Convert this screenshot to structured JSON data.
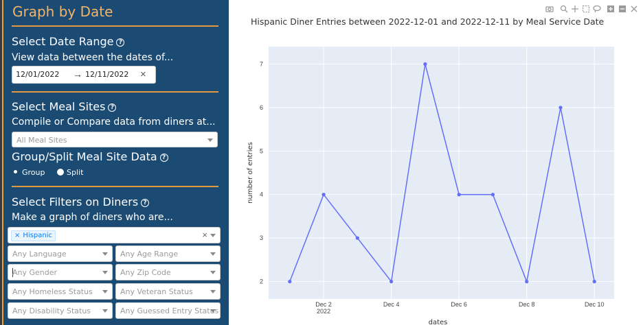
{
  "sidebar": {
    "title": "Graph by Date",
    "date_section": {
      "heading": "Select Date Range",
      "subtitle": "View data between the dates of...",
      "start_date": "12/01/2022",
      "arrow": "→",
      "end_date": "12/11/2022",
      "clear": "×"
    },
    "sites_section": {
      "heading": "Select Meal Sites",
      "subtitle": "Compile or Compare data from diners at...",
      "placeholder": "All Meal Sites"
    },
    "group_section": {
      "heading": "Group/Split Meal Site Data",
      "option_group": "Group",
      "option_split": "Split",
      "selected": "Group"
    },
    "filters_section": {
      "heading": "Select Filters on Diners",
      "subtitle": "Make a graph of diners who are...",
      "tag": "Hispanic",
      "tag_remove": "×",
      "clear_all": "×",
      "dropdowns": [
        {
          "placeholder": "Any Language"
        },
        {
          "placeholder": "Any Age Range"
        },
        {
          "placeholder": "Any Gender"
        },
        {
          "placeholder": "Any Zip Code"
        },
        {
          "placeholder": "Any Homeless Status"
        },
        {
          "placeholder": "Any Veteran Status"
        },
        {
          "placeholder": "Any Disability Status"
        },
        {
          "placeholder": "Any Guessed Entry Status"
        }
      ]
    },
    "help_glyph": "?"
  },
  "modebar": {
    "icons": [
      "camera-icon",
      "zoom-icon",
      "pan-icon",
      "box-select-icon",
      "lasso-icon",
      "zoom-in-icon",
      "zoom-out-icon",
      "autoscale-icon"
    ]
  },
  "chart_data": {
    "type": "line",
    "title": "Hispanic Diner Entries between 2022-12-01 and 2022-12-11 by Meal Service Date",
    "xlabel": "dates",
    "ylabel": "number of entries",
    "x": [
      "2022-12-01",
      "2022-12-02",
      "2022-12-03",
      "2022-12-04",
      "2022-12-05",
      "2022-12-06",
      "2022-12-07",
      "2022-12-08",
      "2022-12-09",
      "2022-12-10"
    ],
    "series": [
      {
        "values": [
          2,
          4,
          3,
          2,
          7,
          4,
          4,
          2,
          6,
          2
        ]
      }
    ],
    "x_ticks": [
      {
        "date": "2022-12-02",
        "label": "Dec 2",
        "sublabel": "2022"
      },
      {
        "date": "2022-12-04",
        "label": "Dec 4",
        "sublabel": ""
      },
      {
        "date": "2022-12-06",
        "label": "Dec 6",
        "sublabel": ""
      },
      {
        "date": "2022-12-08",
        "label": "Dec 8",
        "sublabel": ""
      },
      {
        "date": "2022-12-10",
        "label": "Dec 10",
        "sublabel": ""
      }
    ],
    "y_ticks": [
      2,
      3,
      4,
      5,
      6,
      7
    ],
    "ylim": [
      1.6,
      7.4
    ],
    "xlim": [
      "2022-11-30T09:00",
      "2022-12-10T14:00"
    ],
    "grid": true,
    "colors": {
      "line": "#636efa",
      "plot_bg": "#e5ecf6",
      "grid": "#ffffff"
    }
  }
}
